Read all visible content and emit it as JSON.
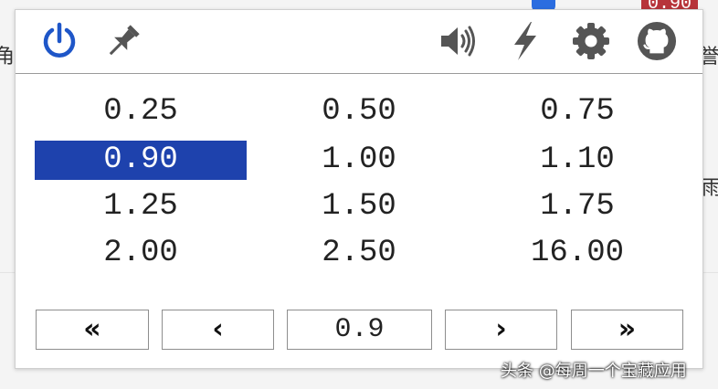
{
  "background": {
    "badge_text": "0.90",
    "fragment_left_top": "角",
    "fragment_right_top": "誉",
    "fragment_right_mid": "雨"
  },
  "toolbar": {
    "power_color": "#1e56c8",
    "icon_color": "#555555"
  },
  "speed_grid": {
    "rows": [
      [
        "0.25",
        "0.50",
        "0.75"
      ],
      [
        "0.90",
        "1.00",
        "1.10"
      ],
      [
        "1.25",
        "1.50",
        "1.75"
      ],
      [
        "2.00",
        "2.50",
        "16.00"
      ]
    ],
    "selected": "0.90",
    "selected_color": "#1e42ad"
  },
  "nav": {
    "fast_back": "«",
    "back": "‹",
    "current_value": "0.9",
    "forward": "›",
    "fast_forward": "»"
  },
  "watermark": "头条 @每周一个宝藏应用"
}
